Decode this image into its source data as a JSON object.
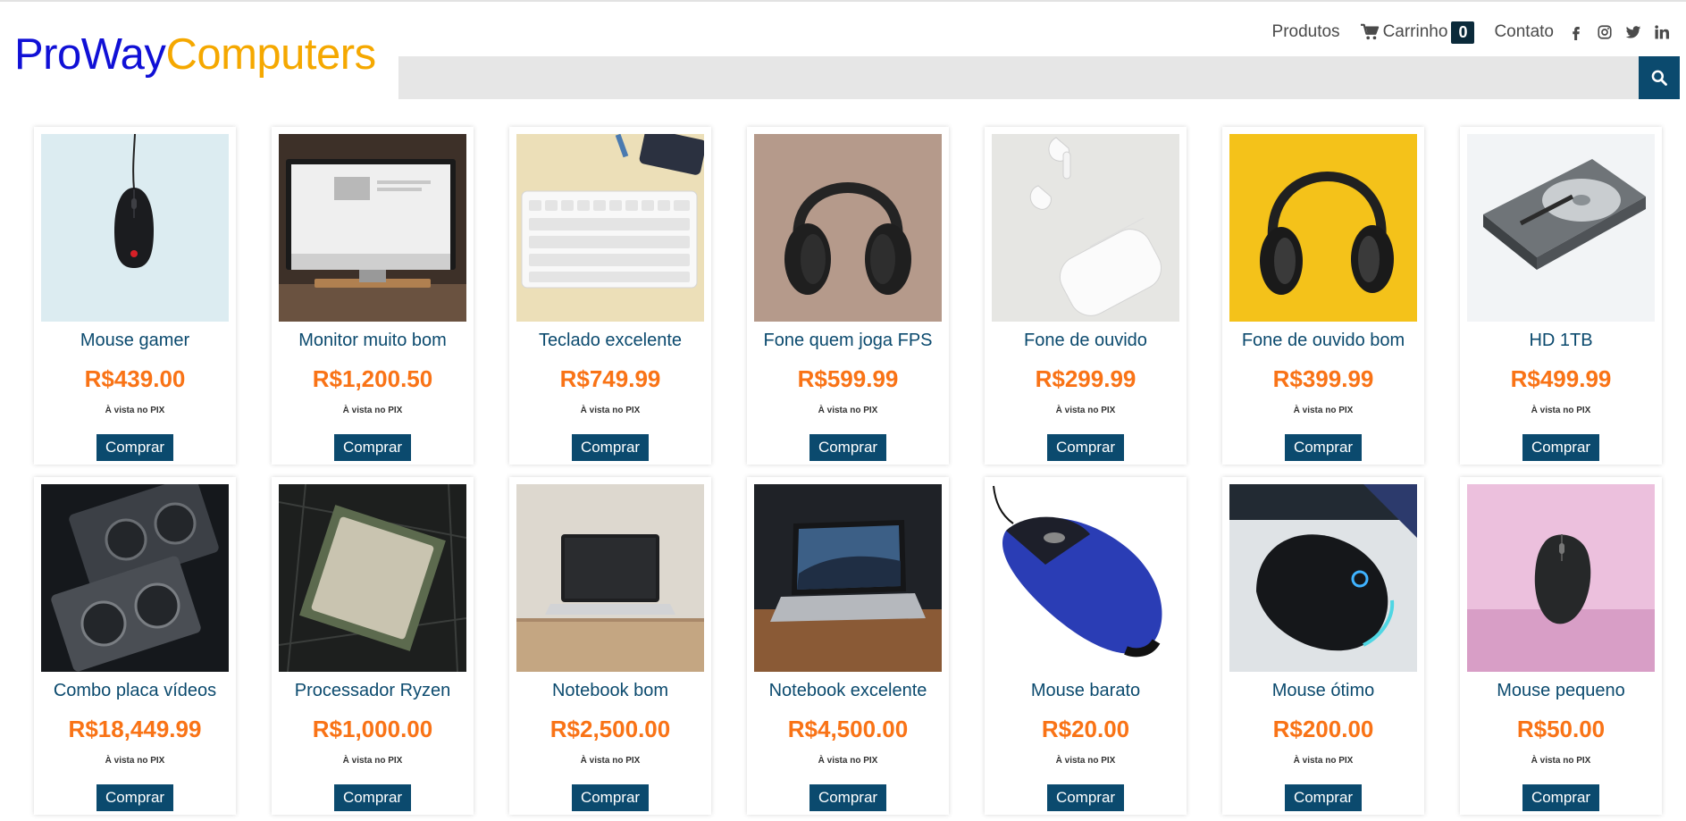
{
  "brand": {
    "part1": "ProWay",
    "part2": "Computers"
  },
  "nav": {
    "products": "Produtos",
    "cart": "Carrinho",
    "cart_count": "0",
    "contact": "Contato"
  },
  "social": [
    "facebook-icon",
    "instagram-icon",
    "twitter-icon",
    "linkedin-icon"
  ],
  "search": {
    "value": "",
    "placeholder": ""
  },
  "colors": {
    "brand_blue": "#1010d6",
    "brand_orange": "#f5a800",
    "accent": "#0b4a6e",
    "price": "#f97316"
  },
  "products": [
    {
      "name": "Mouse gamer",
      "price": "R$439.00",
      "payment": "À vista no PIX",
      "buy": "Comprar"
    },
    {
      "name": "Monitor muito bom",
      "price": "R$1,200.50",
      "payment": "À vista no PIX",
      "buy": "Comprar"
    },
    {
      "name": "Teclado excelente",
      "price": "R$749.99",
      "payment": "À vista no PIX",
      "buy": "Comprar"
    },
    {
      "name": "Fone quem joga FPS",
      "price": "R$599.99",
      "payment": "À vista no PIX",
      "buy": "Comprar"
    },
    {
      "name": "Fone de ouvido",
      "price": "R$299.99",
      "payment": "À vista no PIX",
      "buy": "Comprar"
    },
    {
      "name": "Fone de ouvido bom",
      "price": "R$399.99",
      "payment": "À vista no PIX",
      "buy": "Comprar"
    },
    {
      "name": "HD 1TB",
      "price": "R$499.99",
      "payment": "À vista no PIX",
      "buy": "Comprar"
    },
    {
      "name": "Combo placa vídeos",
      "price": "R$18,449.99",
      "payment": "À vista no PIX",
      "buy": "Comprar"
    },
    {
      "name": "Processador Ryzen",
      "price": "R$1,000.00",
      "payment": "À vista no PIX",
      "buy": "Comprar"
    },
    {
      "name": "Notebook bom",
      "price": "R$2,500.00",
      "payment": "À vista no PIX",
      "buy": "Comprar"
    },
    {
      "name": "Notebook excelente",
      "price": "R$4,500.00",
      "payment": "À vista no PIX",
      "buy": "Comprar"
    },
    {
      "name": "Mouse barato",
      "price": "R$20.00",
      "payment": "À vista no PIX",
      "buy": "Comprar"
    },
    {
      "name": "Mouse ótimo",
      "price": "R$200.00",
      "payment": "À vista no PIX",
      "buy": "Comprar"
    },
    {
      "name": "Mouse pequeno",
      "price": "R$50.00",
      "payment": "À vista no PIX",
      "buy": "Comprar"
    }
  ]
}
